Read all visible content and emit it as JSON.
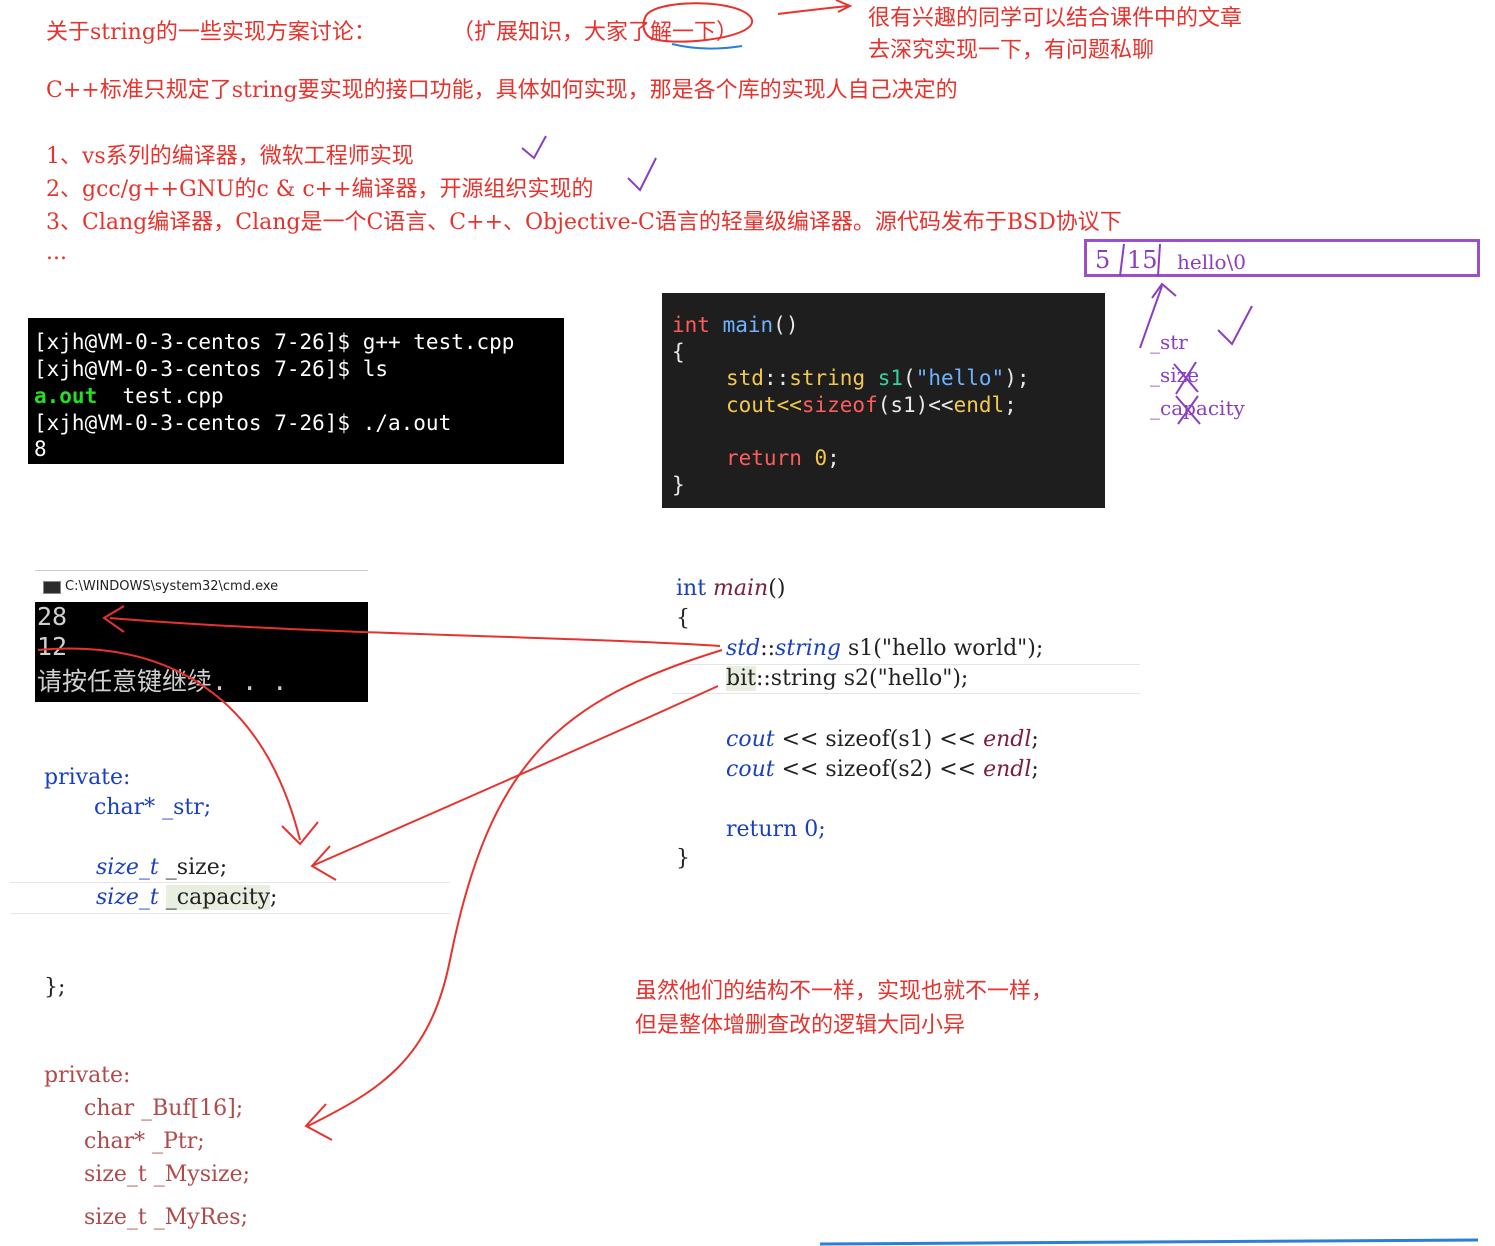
{
  "header": {
    "title": "关于string的一些实现方案讨论：",
    "aside": "（扩展知识，大家了解一下）",
    "interest_line1": "很有兴趣的同学可以结合课件中的文章",
    "interest_line2": "去深究实现一下，有问题私聊",
    "standard_note": "C++标准只规定了string要实现的接口功能，具体如何实现，那是各个库的实现人自己决定的"
  },
  "implementations": [
    "1、vs系列的编译器，微软工程师实现",
    "2、gcc/g++GNU的c & c++编译器，开源组织实现的",
    "3、Clang编译器，Clang是一个C语言、C++、Objective-C语言的轻量级编译器。源代码发布于BSD协议下",
    "..."
  ],
  "memory_box": {
    "cell1": "5",
    "cell2": "15",
    "content": "hello\\0",
    "labels": [
      "_str",
      "_size",
      "_capacity"
    ]
  },
  "linux_terminal": {
    "line1": "[xjh@VM-0-3-centos 7-26]$ g++ test.cpp",
    "line2": "[xjh@VM-0-3-centos 7-26]$ ls",
    "line3_green": "a.out",
    "line3_rest": "  test.cpp",
    "line4": "[xjh@VM-0-3-centos 7-26]$ ./a.out",
    "line5": "8"
  },
  "dark_code": {
    "l1_kw": "int",
    "l1_fn": "main",
    "l1_rest": "()",
    "l2": "{",
    "l3_ns": "std",
    "l3_sep": "::",
    "l3_type": "string",
    "l3_var": "s1",
    "l3_open": "(",
    "l3_str": "\"hello\"",
    "l3_close": ");",
    "l4_a": "cout<<",
    "l4_fn": "sizeof",
    "l4_b": "(s1)<<",
    "l4_endl": "endl",
    "l4_c": ";",
    "l5_kw": "return",
    "l5_num": "0",
    "l5_end": ";",
    "l6": "}"
  },
  "cmd_window": {
    "title": "C:\\WINDOWS\\system32\\cmd.exe",
    "out1": "28",
    "out2": "12",
    "out3": "请按任意键继续. . ."
  },
  "light_code": {
    "l1_kw": "int",
    "l1_fn": "main",
    "l1_rest": "()",
    "l2": "{",
    "l3_ns": "std",
    "l3_rest": "::",
    "l3_type": "string",
    "l3_tail": " s1(\"hello world\");",
    "l4_ns": "bit",
    "l4_rest": "::string s2(\"hello\");",
    "l5_a": "cout",
    "l5_b": " << sizeof(s1) << ",
    "l5_c": "endl",
    "l5_d": ";",
    "l6_a": "cout",
    "l6_b": " << sizeof(s2) << ",
    "l6_c": "endl",
    "l6_d": ";",
    "l7": "return 0;",
    "l8": "}"
  },
  "struct_a": {
    "private": "private:",
    "m1": "char* _str;",
    "m2_type": "size_t",
    "m2_name": " _size;",
    "m3_type": "size_t",
    "m3_name": "_capacity",
    "m3_end": ";",
    "close": "};"
  },
  "struct_b": {
    "private": "private:",
    "m1": "char _Buf[16];",
    "m2": "char* _Ptr;",
    "m3": "size_t _Mysize;",
    "m4": "size_t _MyRes;"
  },
  "conclusion": {
    "line1": "虽然他们的结构不一样，实现也就不一样，",
    "line2": "但是整体增删查改的逻辑大同小异"
  },
  "colors": {
    "note_red": "#e8322d",
    "annotation_purple": "#8a3fc0",
    "code_blue": "#1a40c0",
    "terminal_green": "#23e023"
  }
}
